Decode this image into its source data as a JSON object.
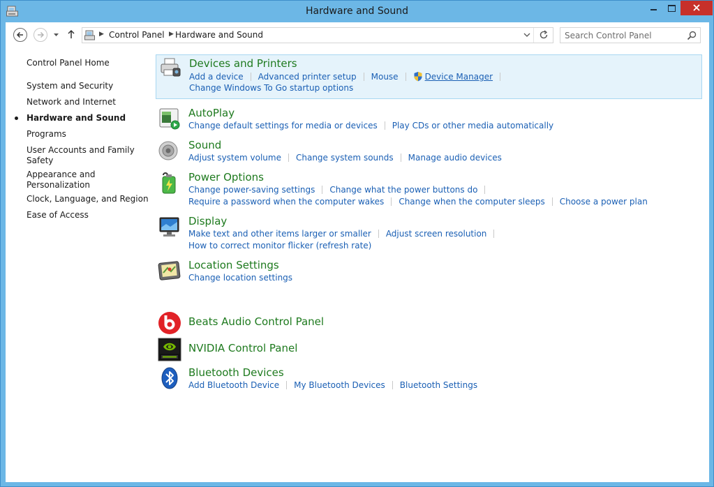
{
  "window": {
    "title": "Hardware and Sound"
  },
  "address": {
    "crumbs": [
      "Control Panel",
      "Hardware and Sound"
    ]
  },
  "search": {
    "placeholder": "Search Control Panel"
  },
  "sidebar": {
    "home": "Control Panel Home",
    "items": [
      {
        "label": "System and Security"
      },
      {
        "label": "Network and Internet"
      },
      {
        "label": "Hardware and Sound",
        "current": true
      },
      {
        "label": "Programs"
      },
      {
        "label": "User Accounts and Family",
        "label2": "Safety"
      },
      {
        "label": "Appearance and",
        "label2": "Personalization"
      },
      {
        "label": "Clock, Language, and Region"
      },
      {
        "label": "Ease of Access"
      }
    ]
  },
  "categories": [
    {
      "title": "Devices and Printers",
      "icon": "devices-printers-icon",
      "rows": [
        [
          "Add a device",
          "Advanced printer setup",
          "Mouse",
          "Device Manager"
        ],
        [
          "Change Windows To Go startup options"
        ]
      ]
    },
    {
      "title": "AutoPlay",
      "icon": "autoplay-icon",
      "rows": [
        [
          "Change default settings for media or devices",
          "Play CDs or other media automatically"
        ]
      ]
    },
    {
      "title": "Sound",
      "icon": "speaker-icon",
      "rows": [
        [
          "Adjust system volume",
          "Change system sounds",
          "Manage audio devices"
        ]
      ]
    },
    {
      "title": "Power Options",
      "icon": "battery-icon",
      "rows": [
        [
          "Change power-saving settings",
          "Change what the power buttons do"
        ],
        [
          "Require a password when the computer wakes",
          "Change when the computer sleeps",
          "Choose a power plan"
        ]
      ]
    },
    {
      "title": "Display",
      "icon": "monitor-icon",
      "rows": [
        [
          "Make text and other items larger or smaller",
          "Adjust screen resolution"
        ],
        [
          "How to correct monitor flicker (refresh rate)"
        ]
      ]
    },
    {
      "title": "Location Settings",
      "icon": "location-icon",
      "rows": [
        [
          "Change location settings"
        ]
      ]
    },
    {
      "title": "Beats Audio Control Panel",
      "icon": "beats-icon",
      "rows": []
    },
    {
      "title": "NVIDIA Control Panel",
      "icon": "nvidia-icon",
      "rows": []
    },
    {
      "title": "Bluetooth Devices",
      "icon": "bluetooth-icon",
      "rows": [
        [
          "Add Bluetooth Device",
          "My Bluetooth Devices",
          "Bluetooth Settings"
        ]
      ]
    }
  ],
  "colors": {
    "category_title": "#1e7a1e",
    "task_link": "#1a5fb4",
    "highlight_bg": "#e5f3fb",
    "frame": "#6cb7e6",
    "close_button": "#c7302a"
  }
}
